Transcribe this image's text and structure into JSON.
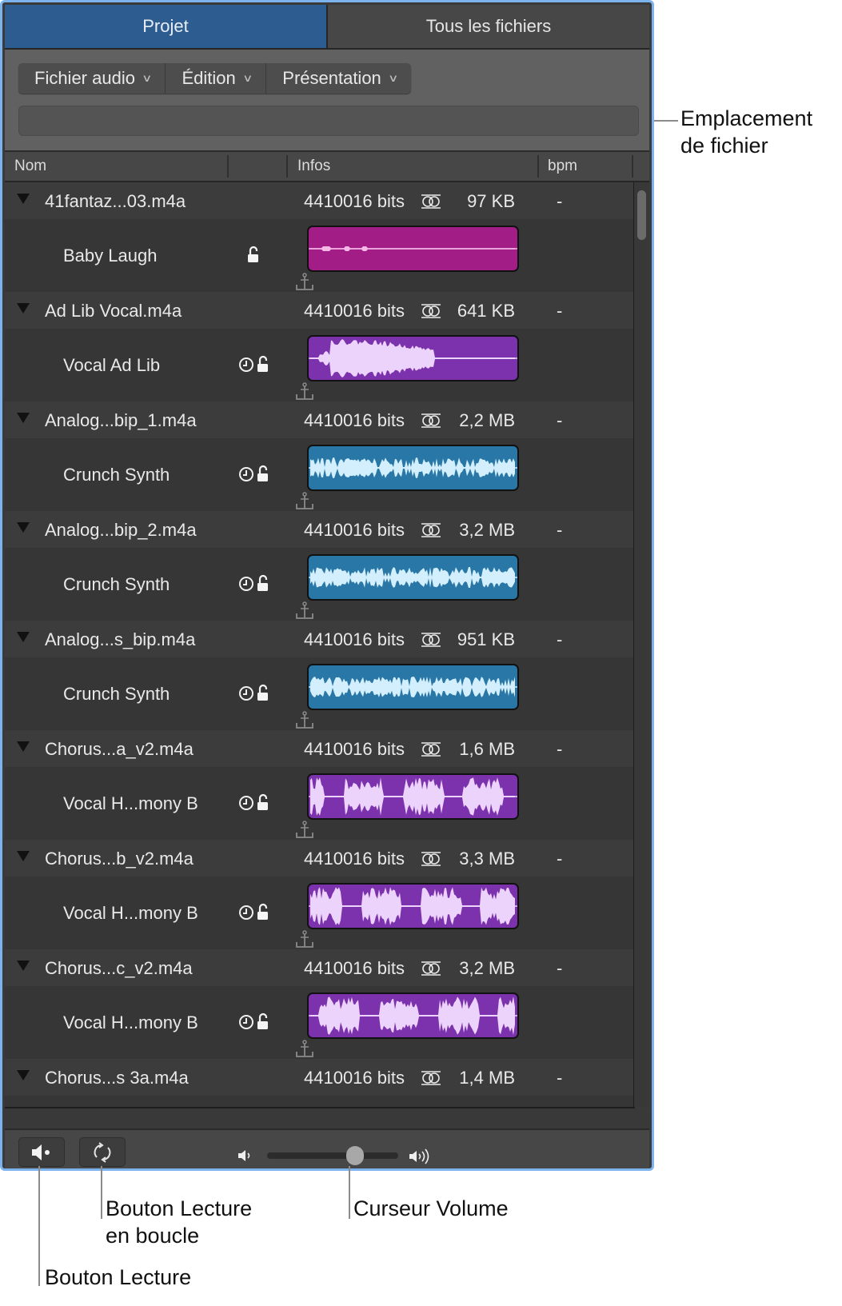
{
  "tabs": [
    {
      "label": "Projet",
      "active": true
    },
    {
      "label": "Tous les fichiers",
      "active": false
    }
  ],
  "menus": [
    {
      "label": "Fichier audio"
    },
    {
      "label": "Édition"
    },
    {
      "label": "Présentation"
    }
  ],
  "file_path": {
    "value": ""
  },
  "columns": {
    "name": "Nom",
    "lock": "",
    "info": "Infos",
    "bpm": "bpm"
  },
  "files": [
    {
      "file": "41fantaz...03.m4a",
      "info": "4410016 bits",
      "size": "97 KB",
      "bpm": "-",
      "region": {
        "name": "Baby Laugh",
        "color": "#a31d87",
        "wave": "#f4b8e7",
        "shape": "sparse",
        "time_locked_icon": false
      }
    },
    {
      "file": "Ad Lib Vocal.m4a",
      "info": "4410016 bits",
      "size": "641 KB",
      "bpm": "-",
      "region": {
        "name": "Vocal Ad Lib",
        "color": "#7c31ad",
        "wave": "#ecd3fb",
        "shape": "swell",
        "time_locked_icon": true
      }
    },
    {
      "file": "Analog...bip_1.m4a",
      "info": "4410016 bits",
      "size": "2,2 MB",
      "bpm": "-",
      "region": {
        "name": "Crunch Synth",
        "color": "#2877a6",
        "wave": "#d3effd",
        "shape": "dense",
        "time_locked_icon": true
      }
    },
    {
      "file": "Analog...bip_2.m4a",
      "info": "4410016 bits",
      "size": "3,2 MB",
      "bpm": "-",
      "region": {
        "name": "Crunch Synth",
        "color": "#2877a6",
        "wave": "#d3effd",
        "shape": "dense",
        "time_locked_icon": true
      }
    },
    {
      "file": "Analog...s_bip.m4a",
      "info": "4410016 bits",
      "size": "951 KB",
      "bpm": "-",
      "region": {
        "name": "Crunch Synth",
        "color": "#2877a6",
        "wave": "#d3effd",
        "shape": "dense",
        "time_locked_icon": true
      }
    },
    {
      "file": "Chorus...a_v2.m4a",
      "info": "4410016 bits",
      "size": "1,6 MB",
      "bpm": "-",
      "region": {
        "name": "Vocal H...mony B",
        "color": "#7c31ad",
        "wave": "#ecd3fb",
        "shape": "bursts",
        "time_locked_icon": true
      }
    },
    {
      "file": "Chorus...b_v2.m4a",
      "info": "4410016 bits",
      "size": "3,3 MB",
      "bpm": "-",
      "region": {
        "name": "Vocal H...mony B",
        "color": "#7c31ad",
        "wave": "#ecd3fb",
        "shape": "bursts",
        "time_locked_icon": true
      }
    },
    {
      "file": "Chorus...c_v2.m4a",
      "info": "4410016 bits",
      "size": "3,2 MB",
      "bpm": "-",
      "region": {
        "name": "Vocal H...mony B",
        "color": "#7c31ad",
        "wave": "#ecd3fb",
        "shape": "bursts",
        "time_locked_icon": true
      }
    },
    {
      "file": "Chorus...s 3a.m4a",
      "info": "4410016 bits",
      "size": "1,4 MB",
      "bpm": "-",
      "region": {
        "name": "",
        "color": "#7c31ad",
        "wave": "#ecd3fb",
        "shape": "none",
        "time_locked_icon": false
      }
    }
  ],
  "controls": {
    "play_icon": "speaker-play-icon",
    "loop_icon": "loop-icon",
    "volume_percent": 67
  },
  "callouts": {
    "file_location": [
      "Emplacement",
      "de fichier"
    ],
    "loop_button": [
      "Bouton Lecture",
      "en boucle"
    ],
    "volume_slider": "Curseur Volume",
    "play_button": "Bouton Lecture"
  },
  "colors": {
    "accent_tab": "#2d5c91",
    "window_border": "#7db3ec"
  }
}
